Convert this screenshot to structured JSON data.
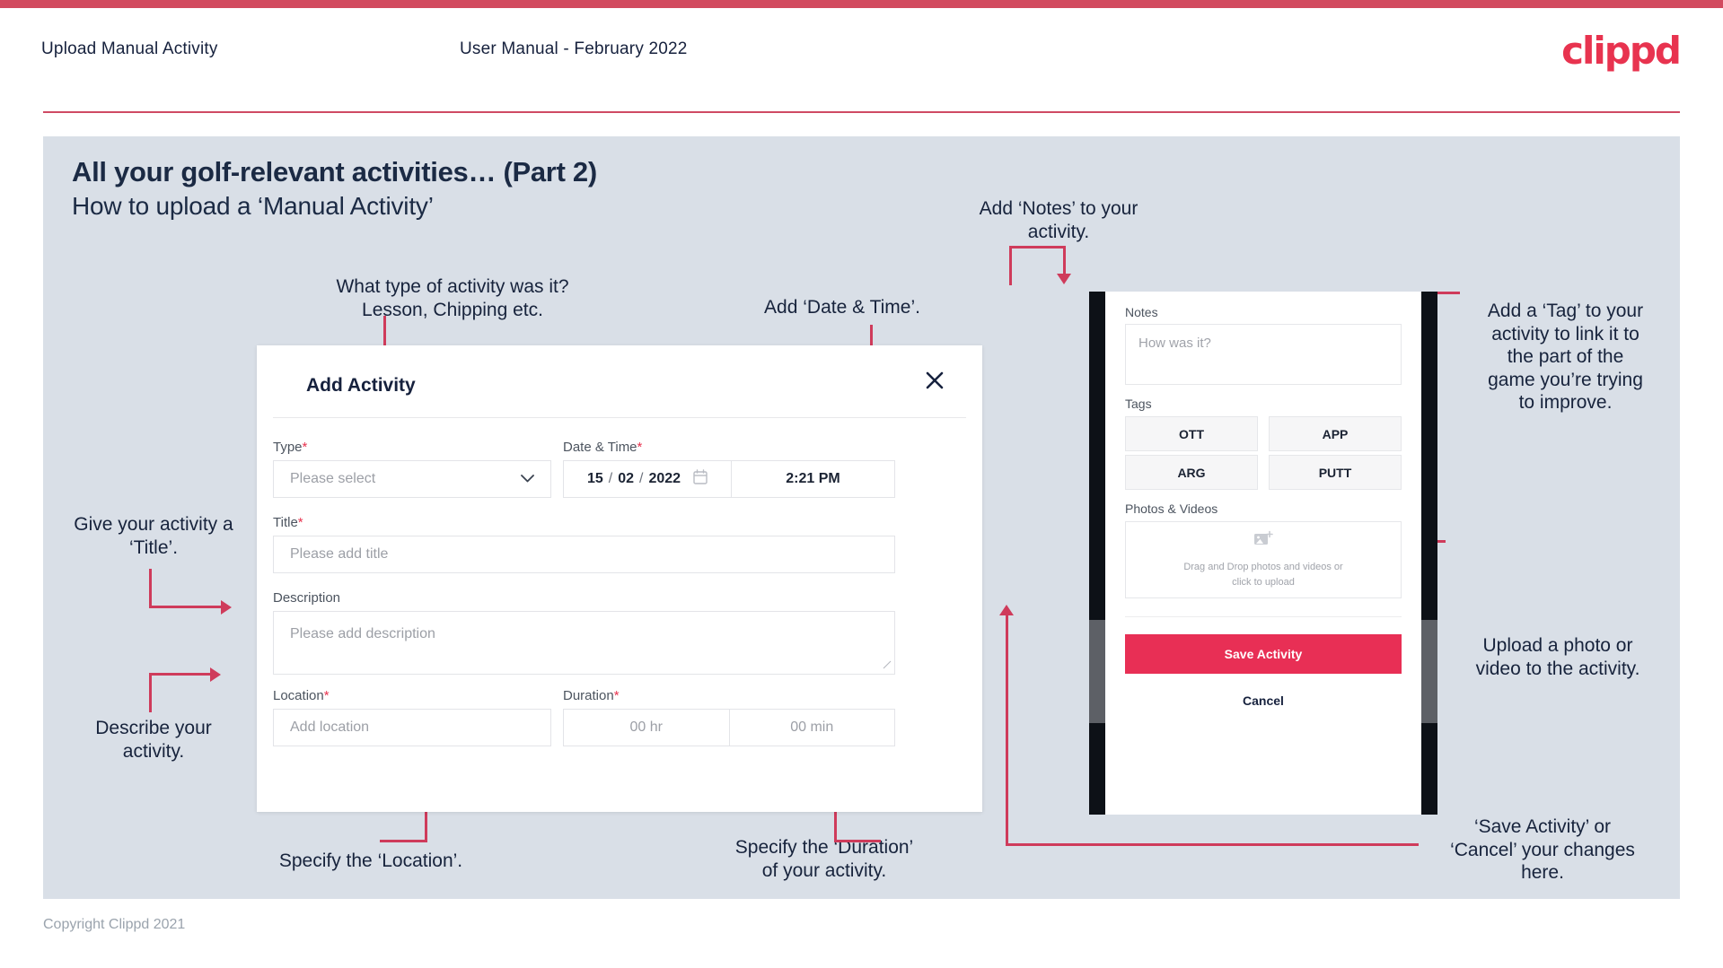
{
  "header": {
    "title": "Upload Manual Activity",
    "subtitle": "User Manual - February 2022",
    "logo": "clippd"
  },
  "slide": {
    "heading": "All your golf-relevant activities… (Part 2)",
    "subheading": "How to upload a ‘Manual Activity’",
    "copyright": "Copyright Clippd 2021"
  },
  "dialog": {
    "title": "Add Activity",
    "close_icon": "close-icon",
    "fields": {
      "type": {
        "label": "Type",
        "required": "*",
        "placeholder": "Please select",
        "chevron": "chevron-down-icon"
      },
      "datetime": {
        "label": "Date & Time",
        "required": "*",
        "day": "15",
        "month": "02",
        "year": "2022",
        "sep": "/",
        "calendar_icon": "calendar-icon",
        "time": "2:21 PM"
      },
      "title": {
        "label": "Title",
        "required": "*",
        "placeholder": "Please add title"
      },
      "description": {
        "label": "Description",
        "required": "",
        "placeholder": "Please add description"
      },
      "location": {
        "label": "Location",
        "required": "*",
        "placeholder": "Add location"
      },
      "duration": {
        "label": "Duration",
        "required": "*",
        "hours": "00 hr",
        "minutes": "00 min"
      }
    }
  },
  "phone": {
    "notes": {
      "label": "Notes",
      "placeholder": "How was it?"
    },
    "tags": {
      "label": "Tags",
      "items": [
        "OTT",
        "APP",
        "ARG",
        "PUTT"
      ]
    },
    "photos": {
      "label": "Photos & Videos",
      "icon": "add-image-icon",
      "drop_line1": "Drag and Drop photos and videos or",
      "drop_line2": "click to upload"
    },
    "save_label": "Save Activity",
    "cancel_label": "Cancel"
  },
  "annotations": {
    "type": "What type of activity was it?\nLesson, Chipping etc.",
    "datetime": "Add ‘Date & Time’.",
    "title": "Give your activity a\n‘Title’.",
    "description": "Describe your\nactivity.",
    "location": "Specify the ‘Location’.",
    "duration": "Specify the ‘Duration’\nof your activity.",
    "notes": "Add ‘Notes’ to your\nactivity.",
    "tags": "Add a ‘Tag’ to your\nactivity to link it to\nthe part of the\ngame you’re trying\nto improve.",
    "photos": "Upload a photo or\nvideo to the activity.",
    "save": "‘Save Activity’ or\n‘Cancel’ your changes\nhere."
  },
  "colors": {
    "accent": "#e8334f",
    "brand_bar": "#d24a5f",
    "annotation_line": "#cf3b5b",
    "slide_bg": "#d9dfe7",
    "text_dark": "#16213d"
  }
}
